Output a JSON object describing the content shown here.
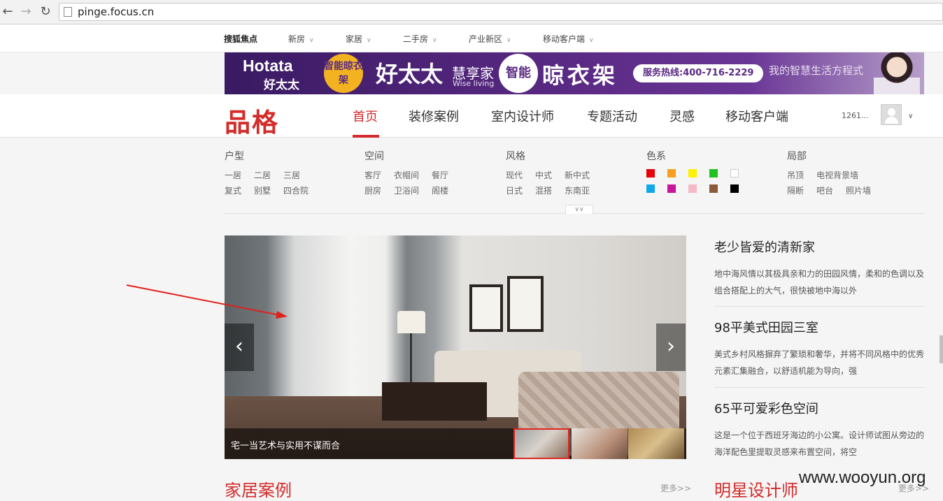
{
  "browser": {
    "url": "pinge.focus.cn",
    "back_icon": "back-arrow-icon",
    "forward_icon": "forward-arrow-icon",
    "reload_icon": "reload-icon"
  },
  "topnav": {
    "brand": "搜狐焦点",
    "items": [
      "新房",
      "家居",
      "二手房",
      "产业新区",
      "移动客户端"
    ]
  },
  "banner": {
    "brand_en": "Hotata",
    "brand_cn": "好太太",
    "badge": "智能晾衣架",
    "headline": "好太太",
    "sub_cn": "慧享家",
    "sub_en": "Wise living",
    "badge2": "智能",
    "product": "晾衣架",
    "hotline": "服务热线:400-716-2229",
    "slogan": "我的智慧生活方程式"
  },
  "header": {
    "logo": "品格",
    "nav": [
      "首页",
      "装修案例",
      "室内设计师",
      "专题活动",
      "灵感",
      "移动客户端"
    ],
    "active_index": 0,
    "user_id": "1261...",
    "accent": "#d42b2b"
  },
  "filters": {
    "huxing": {
      "title": "户型",
      "row1": [
        "一居",
        "二居",
        "三居"
      ],
      "row2": [
        "复式",
        "别墅",
        "四合院"
      ]
    },
    "kongjian": {
      "title": "空间",
      "row1": [
        "客厅",
        "衣帽间",
        "餐厅"
      ],
      "row2": [
        "厨房",
        "卫浴间",
        "阁楼"
      ]
    },
    "fengge": {
      "title": "风格",
      "row1": [
        "现代",
        "中式",
        "新中式"
      ],
      "row2": [
        "日式",
        "混搭",
        "东南亚"
      ]
    },
    "sexi": {
      "title": "色系",
      "row1": [
        "#e8000b",
        "#f5a020",
        "#fff200",
        "#1fc21f",
        "#ffffff"
      ],
      "row2": [
        "#10a8e8",
        "#c8159b",
        "#f5b8c6",
        "#8a5a3c",
        "#000000"
      ]
    },
    "jubu": {
      "title": "局部",
      "row1": [
        "吊顶",
        "电视背景墙"
      ],
      "row2": [
        "隔断",
        "吧台",
        "照片墙"
      ]
    }
  },
  "carousel": {
    "caption": "宅一当艺术与实用不谋而合",
    "prev_icon": "chevron-left-icon",
    "next_icon": "chevron-right-icon",
    "thumbnails": 3,
    "selected_thumb": 0
  },
  "articles": [
    {
      "title": "老少皆爱的清新家",
      "desc": "地中海风情以其极具亲和力的田园风情，柔和的色调以及组合搭配上的大气，很快被地中海以外"
    },
    {
      "title": "98平美式田园三室",
      "desc": "美式乡村风格摒弃了繁琐和奢华，并将不同风格中的优秀元素汇集融合，以舒适机能为导向，强"
    },
    {
      "title": "65平可爱彩色空间",
      "desc": "这是一个位于西班牙海边的小公寓。设计师试图从旁边的海洋配色里提取灵感来布置空间，将空"
    }
  ],
  "sections": {
    "cases": "家居案例",
    "designers": "明星设计师",
    "more": "更多>>"
  },
  "watermark": "www.wooyun.org"
}
